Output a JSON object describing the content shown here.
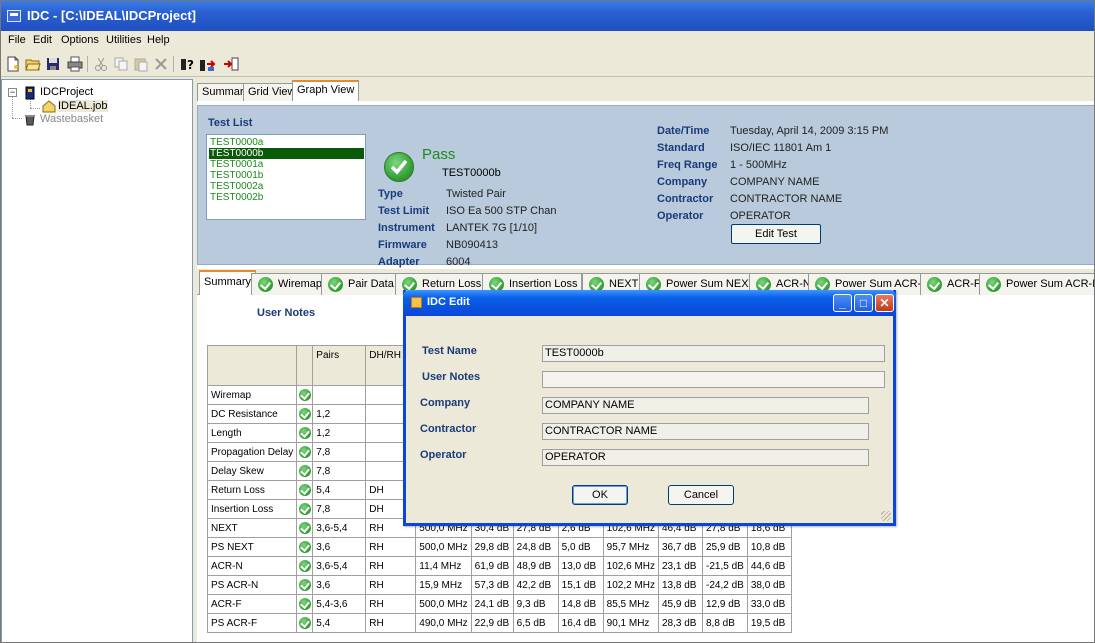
{
  "window": {
    "title": "IDC - [C:\\IDEAL\\IDCProject]"
  },
  "menu": [
    "File",
    "Edit",
    "Options",
    "Utilities",
    "Help"
  ],
  "toolbar": {
    "icons": [
      "new-file-icon",
      "open-folder-icon",
      "save-icon",
      "print-icon",
      "cut-icon",
      "copy-icon",
      "paste-icon",
      "delete-icon",
      "help-icon",
      "transfer-icon",
      "import-icon"
    ]
  },
  "tree": {
    "root": "IDCProject",
    "job": "IDEAL.job",
    "wastebasket": "Wastebasket",
    "expander": "−"
  },
  "top_tabs": [
    "Summary",
    "Grid View",
    "Graph View"
  ],
  "test_list": {
    "title": "Test List",
    "items": [
      "TEST0000a",
      "TEST0000b",
      "TEST0001a",
      "TEST0001b",
      "TEST0002a",
      "TEST0002b"
    ],
    "selected_index": 1
  },
  "result": {
    "status": "Pass",
    "test_name": "TEST0000b",
    "left_fields": [
      {
        "label": "Type",
        "value": "Twisted Pair"
      },
      {
        "label": "Test Limit",
        "value": "ISO Ea 500 STP Chan"
      },
      {
        "label": "Instrument",
        "value": "LANTEK 7G [1/10]"
      },
      {
        "label": "Firmware",
        "value": "NB090413"
      },
      {
        "label": "Adapter",
        "value": "6004"
      }
    ],
    "right_fields": [
      {
        "label": "Date/Time",
        "value": "Tuesday, April 14, 2009 3:15 PM"
      },
      {
        "label": "Standard",
        "value": "ISO/IEC 11801 Am 1"
      },
      {
        "label": "Freq Range",
        "value": "1 - 500MHz"
      },
      {
        "label": "Company",
        "value": "COMPANY NAME"
      },
      {
        "label": "Contractor",
        "value": "CONTRACTOR NAME"
      },
      {
        "label": "Operator",
        "value": "OPERATOR"
      }
    ],
    "edit_button": "Edit Test"
  },
  "result_tabs": [
    "Summary",
    "Wiremap",
    "Pair Data",
    "Return Loss",
    "Insertion Loss",
    "NEXT",
    "Power Sum NEXT",
    "ACR-N",
    "Power Sum ACR-N",
    "ACR-F",
    "Power Sum ACR-F"
  ],
  "summary": {
    "user_notes_label": "User Notes",
    "headers": [
      "",
      "",
      "Pairs",
      "DH/RH",
      "",
      "",
      "",
      "",
      "",
      "",
      "",
      ""
    ],
    "rows": [
      {
        "name": "Wiremap",
        "pairs": "",
        "dh": "",
        "c": [
          "",
          "",
          "",
          "",
          "",
          "",
          "",
          ""
        ]
      },
      {
        "name": "DC Resistance",
        "pairs": "1,2",
        "dh": "",
        "c": [
          "",
          "",
          "",
          "",
          "",
          "",
          "",
          ""
        ]
      },
      {
        "name": "Length",
        "pairs": "1,2",
        "dh": "",
        "c": [
          "",
          "",
          "",
          "",
          "",
          "",
          "",
          ""
        ]
      },
      {
        "name": "Propagation Delay",
        "pairs": "7,8",
        "dh": "",
        "c": [
          "",
          "",
          "",
          "",
          "",
          "",
          "",
          ""
        ]
      },
      {
        "name": "Delay Skew",
        "pairs": "7,8",
        "dh": "",
        "c": [
          "",
          "",
          "",
          "",
          "",
          "",
          "",
          ""
        ]
      },
      {
        "name": "Return Loss",
        "pairs": "5,4",
        "dh": "DH",
        "c": [
          "",
          "",
          "",
          "",
          "",
          "",
          "",
          ""
        ]
      },
      {
        "name": "Insertion Loss",
        "pairs": "7,8",
        "dh": "DH",
        "c": [
          "",
          "",
          "",
          "",
          "",
          "",
          "",
          ""
        ]
      },
      {
        "name": "NEXT",
        "pairs": "3,6-5,4",
        "dh": "RH",
        "c": [
          "500,0 MHz",
          "30,4 dB",
          "27,8 dB",
          "2,6 dB",
          "102,6 MHz",
          "46,4 dB",
          "27,8 dB",
          "18,6 dB"
        ]
      },
      {
        "name": "PS NEXT",
        "pairs": "3,6",
        "dh": "RH",
        "c": [
          "500,0 MHz",
          "29,8 dB",
          "24,8 dB",
          "5,0 dB",
          "95,7 MHz",
          "36,7 dB",
          "25,9 dB",
          "10,8 dB"
        ]
      },
      {
        "name": "ACR-N",
        "pairs": "3,6-5,4",
        "dh": "RH",
        "c": [
          "11,4 MHz",
          "61,9 dB",
          "48,9 dB",
          "13,0 dB",
          "102,6 MHz",
          "23,1 dB",
          "-21,5 dB",
          "44,6 dB"
        ]
      },
      {
        "name": "PS ACR-N",
        "pairs": "3,6",
        "dh": "RH",
        "c": [
          "15,9 MHz",
          "57,3 dB",
          "42,2 dB",
          "15,1 dB",
          "102,2 MHz",
          "13,8 dB",
          "-24,2 dB",
          "38,0 dB"
        ]
      },
      {
        "name": "ACR-F",
        "pairs": "5,4-3,6",
        "dh": "RH",
        "c": [
          "500,0 MHz",
          "24,1 dB",
          "9,3 dB",
          "14,8 dB",
          "85,5 MHz",
          "45,9 dB",
          "12,9 dB",
          "33,0 dB"
        ]
      },
      {
        "name": "PS ACR-F",
        "pairs": "5,4",
        "dh": "RH",
        "c": [
          "490,0 MHz",
          "22,9 dB",
          "6,5 dB",
          "16,4 dB",
          "90,1 MHz",
          "28,3 dB",
          "8,8 dB",
          "19,5 dB"
        ]
      }
    ]
  },
  "dialog": {
    "title": "IDC Edit",
    "fields": [
      {
        "label": "Test Name",
        "value": "TEST0000b"
      },
      {
        "label": "User Notes",
        "value": ""
      },
      {
        "label": "Company",
        "value": "COMPANY NAME"
      },
      {
        "label": "Contractor",
        "value": "CONTRACTOR NAME"
      },
      {
        "label": "Operator",
        "value": "OPERATOR"
      }
    ],
    "ok": "OK",
    "cancel": "Cancel",
    "minimize": "_",
    "maximize": "□",
    "close": "✕"
  }
}
